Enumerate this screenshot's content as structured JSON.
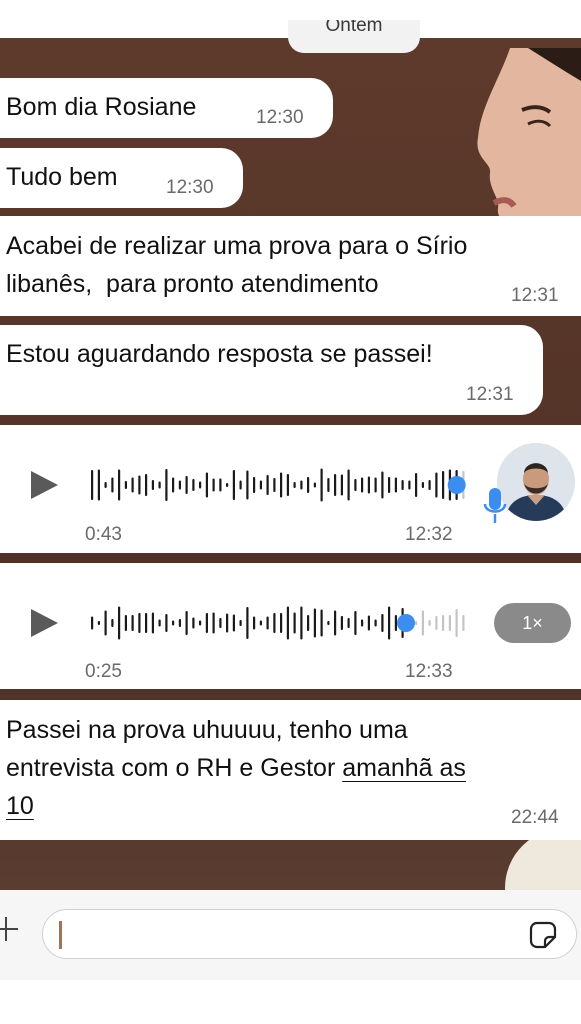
{
  "chat": {
    "date_separator": "Ontem",
    "messages": [
      {
        "text": "Bom dia Rosiane",
        "time": "12:30"
      },
      {
        "text": "Tudo bem",
        "time": "12:30"
      },
      {
        "line1": "Acabei de realizar uma prova para o Sírio",
        "line2": "libanês,  para pronto atendimento",
        "time": "12:31"
      },
      {
        "text": "Estou aguardando resposta se passei!",
        "time": "12:31"
      }
    ],
    "audio1": {
      "duration": "0:43",
      "time": "12:32",
      "progress": 1.0
    },
    "audio2": {
      "duration": "0:25",
      "time": "12:33",
      "speed": "1×",
      "progress": 0.95
    },
    "last_message": {
      "line1": "Passei na prova uhuuuu, tenho uma",
      "line2_plain": "entrevista com o RH e Gestor ",
      "line2_link": "amanhã as",
      "line3_link": "10",
      "time": "22:44"
    }
  },
  "composer": {
    "placeholder": ""
  },
  "colors": {
    "accent_blue": "#3b8df0",
    "chat_background": "#553528",
    "bubble": "#ffffff"
  },
  "icons": {
    "play": "play-icon",
    "mic": "mic-icon",
    "sticker": "sticker-icon",
    "plus": "plus-icon"
  }
}
